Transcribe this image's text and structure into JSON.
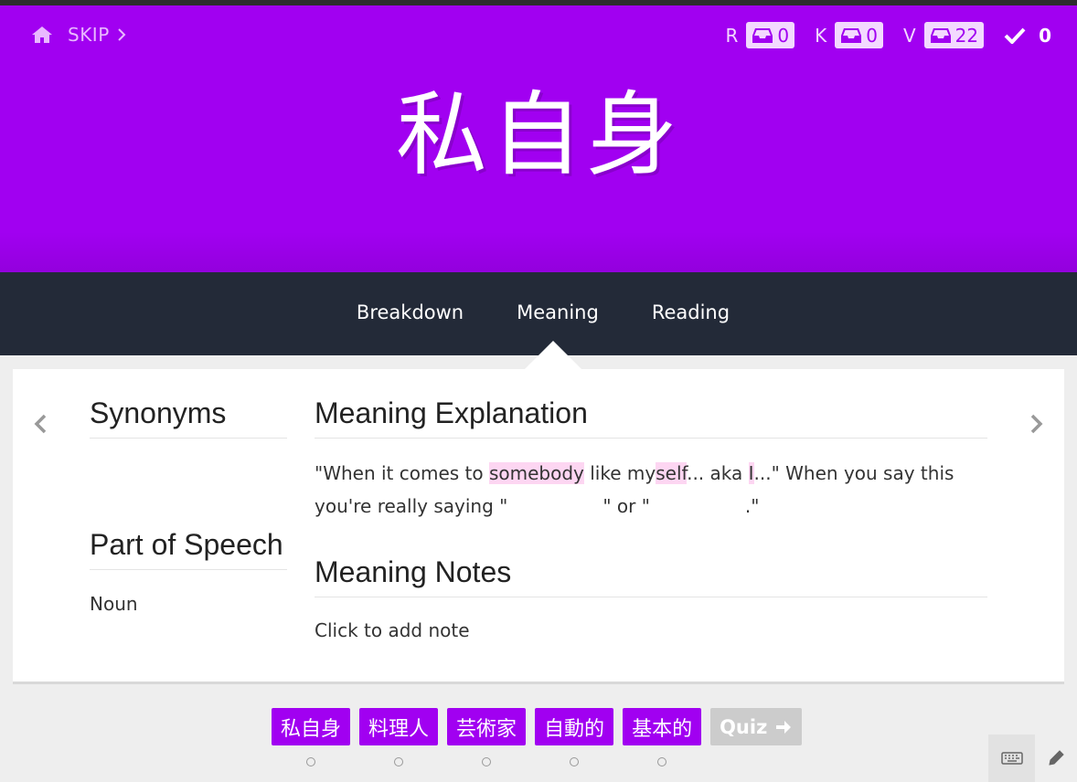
{
  "colors": {
    "accent": "#a100f1",
    "tabbar": "#232a38",
    "highlight": "#fdd6f2",
    "quiz_disabled": "#cccccc"
  },
  "header": {
    "skip_label": "SKIP",
    "character": "私自身",
    "stats": [
      {
        "label": "R",
        "icon": "inbox-icon",
        "count": "0"
      },
      {
        "label": "K",
        "icon": "inbox-icon",
        "count": "0"
      },
      {
        "label": "V",
        "icon": "inbox-icon",
        "count": "22"
      }
    ],
    "completed": {
      "icon": "checkmark-icon",
      "count": "0"
    }
  },
  "tabs": [
    "Breakdown",
    "Meaning",
    "Reading"
  ],
  "active_tab": "Meaning",
  "synonyms": {
    "title": "Synonyms"
  },
  "part_of_speech": {
    "title": "Part of Speech",
    "value": "Noun"
  },
  "meaning_explanation": {
    "title": "Meaning Explanation",
    "segments": [
      "\"When it comes to ",
      "somebody",
      " like my",
      "self",
      "... aka ",
      "I",
      "...\" When you say this you're really saying \"",
      "\" or \"",
      ".\""
    ]
  },
  "meaning_notes": {
    "title": "Meaning Notes",
    "placeholder": "Click to add note"
  },
  "batch": {
    "items": [
      "私自身",
      "料理人",
      "芸術家",
      "自動的",
      "基本的"
    ],
    "quiz_label": "Quiz"
  }
}
